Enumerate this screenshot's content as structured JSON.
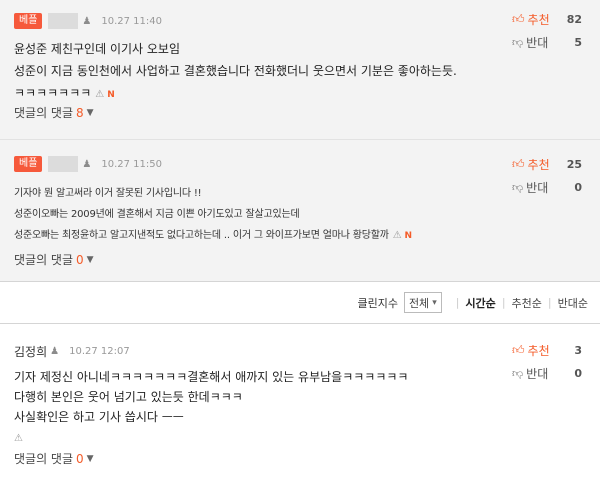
{
  "comments": [
    {
      "badge": "베플",
      "date": "10.27 11:40",
      "recommend_label": "추천",
      "recommend_count": "82",
      "oppose_label": "반대",
      "oppose_count": "5",
      "lines": [
        "윤성준 제친구인데 이기사 오보임",
        "성준이 지금 동인천에서 사업하고 결혼했습니다 전화했더니 웃으면서 기분은 좋아하는듯.",
        "ㅋㅋㅋㅋㅋㅋㅋ"
      ],
      "new_badge": "N",
      "reply_label": "댓글의 댓글",
      "reply_count": "8"
    },
    {
      "badge": "베플",
      "date": "10.27 11:50",
      "recommend_label": "추천",
      "recommend_count": "25",
      "oppose_label": "반대",
      "oppose_count": "0",
      "lines": [
        "기자야 뭔 알고써라 이거 잘못된 기사입니다 !!",
        "성준이오빠는 2009년에 결혼해서 지금 이쁜 아기도있고 잘살고있는데",
        "성준오빠는 최정윤하고 알고지낸적도 없다고하는데 .. 이거 그 와이프가보면 얼마나 황당할까"
      ],
      "new_badge": "N",
      "reply_label": "댓글의 댓글",
      "reply_count": "0"
    },
    {
      "name": "김정희",
      "date": "10.27 12:07",
      "recommend_label": "추천",
      "recommend_count": "3",
      "oppose_label": "반대",
      "oppose_count": "0",
      "lines": [
        "기자 제정신 아니네ㅋㅋㅋㅋㅋㅋㅋ결혼해서 애까지 있는 유부남을ㅋㅋㅋㅋㅋㅋ",
        "다행히 본인은 웃어 넘기고 있는듯 한데ㅋㅋㅋ",
        "사실확인은 하고 기사 씁시다 ㅡㅡ"
      ],
      "reply_label": "댓글의 댓글",
      "reply_count": "0"
    }
  ],
  "sortbar": {
    "cleanbot": "클린지수",
    "filter": "전체",
    "sorts": [
      "시간순",
      "추천순",
      "반대순"
    ]
  }
}
